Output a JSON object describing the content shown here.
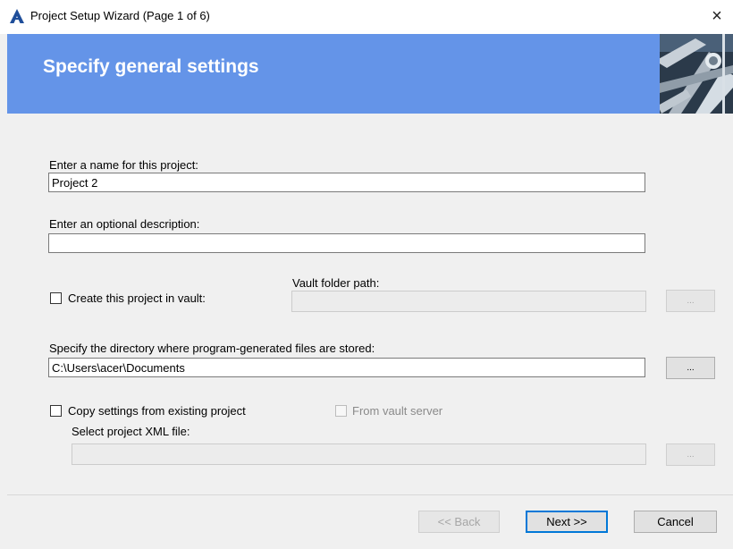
{
  "window": {
    "title": "Project Setup Wizard (Page 1 of 6)",
    "close_glyph": "×"
  },
  "banner": {
    "heading": "Specify general settings",
    "image": "pipes-image"
  },
  "form": {
    "name_label": "Enter a name for this project:",
    "name_value": "Project 2",
    "description_label": "Enter an optional description:",
    "description_value": "",
    "vault_checkbox_label": "Create this project in vault:",
    "vault_checked": false,
    "vault_folder_label": "Vault folder path:",
    "vault_folder_value": "",
    "vault_browse_label": "...",
    "directory_label": "Specify the directory where program-generated files are stored:",
    "directory_value": "C:\\Users\\acer\\Documents",
    "directory_browse_label": "...",
    "copy_checkbox_label": "Copy settings from existing project",
    "copy_checked": false,
    "from_vault_label": "From vault server",
    "from_vault_checked": false,
    "xml_label": "Select project XML file:",
    "xml_value": "",
    "xml_browse_label": "..."
  },
  "footer": {
    "back_label": "<< Back",
    "next_label": "Next >>",
    "cancel_label": "Cancel"
  },
  "colors": {
    "banner": "#6494e8",
    "dialog_bg": "#f0f0f0",
    "accent": "#0078d7"
  }
}
